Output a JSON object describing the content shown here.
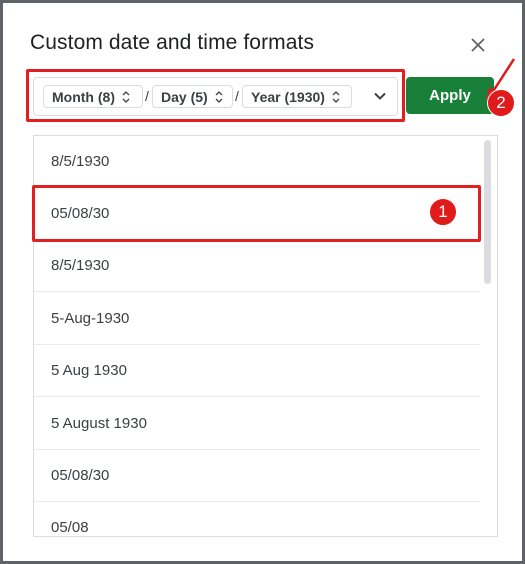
{
  "dialog": {
    "title": "Custom date and time formats",
    "close_icon": "close-icon"
  },
  "format_bar": {
    "chips": [
      {
        "label": "Month (8)"
      },
      {
        "label": "Day (5)"
      },
      {
        "label": "Year (1930)"
      }
    ],
    "separators": [
      "/",
      "/"
    ],
    "dropdown_icon": "chevron-down-icon"
  },
  "apply_button": {
    "label": "Apply",
    "color": "#188038"
  },
  "format_list": {
    "items": [
      "8/5/1930",
      "05/08/30",
      "8/5/1930",
      "5-Aug-1930",
      "5 Aug 1930",
      "5 August 1930",
      "05/08/30",
      "05/08"
    ]
  },
  "annotations": {
    "highlight_color": "#e02020",
    "badge_1": "1",
    "badge_2": "2"
  }
}
